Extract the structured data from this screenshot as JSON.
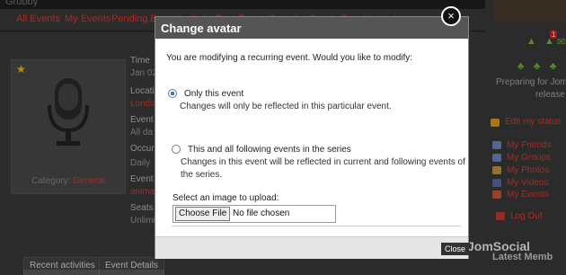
{
  "header": {
    "site_title_fragment": "Grubby"
  },
  "nav": [
    "All Events",
    "My Events",
    "Pending Event Invitations",
    "Past Events",
    "Search",
    "Create Event",
    "Import"
  ],
  "event_panel": {
    "category_label": "Category:",
    "category_value": "General",
    "labels": [
      "Time",
      "Jan 02",
      "Locati",
      "Londo",
      "Event S",
      "All da",
      "Occurr",
      "Daily",
      "Event A",
      "anima",
      "Seats",
      "Unlimi"
    ]
  },
  "bottom_tabs": [
    "Recent activities",
    "Event Details"
  ],
  "modal": {
    "title": "Change avatar",
    "question": "You are modifying a recurring event. Would you like to modify:",
    "option1_label": "Only this event",
    "option1_desc": "Changes will only be reflected in this particular event.",
    "option2_label": "This and all following events in the series",
    "option2_desc_line1": "Changes in this event will be reflected in current and following events of",
    "option2_desc_line2": "the series.",
    "upload_label": "Select an image to upload:",
    "choose_file": "Choose File",
    "no_file": "No file chosen",
    "close_button": "Close",
    "close_icon": "×"
  },
  "sidebar": {
    "badge_count": "1",
    "preparing_text": "Preparing for Jom",
    "release_text": "release",
    "edit_status": "Edit my status",
    "links": [
      "My Friends",
      "My Groups",
      "My Photos",
      "My Videos",
      "My Events"
    ],
    "logout": "Log Out",
    "latest": "Latest Memb",
    "brand": "JomSocial"
  }
}
